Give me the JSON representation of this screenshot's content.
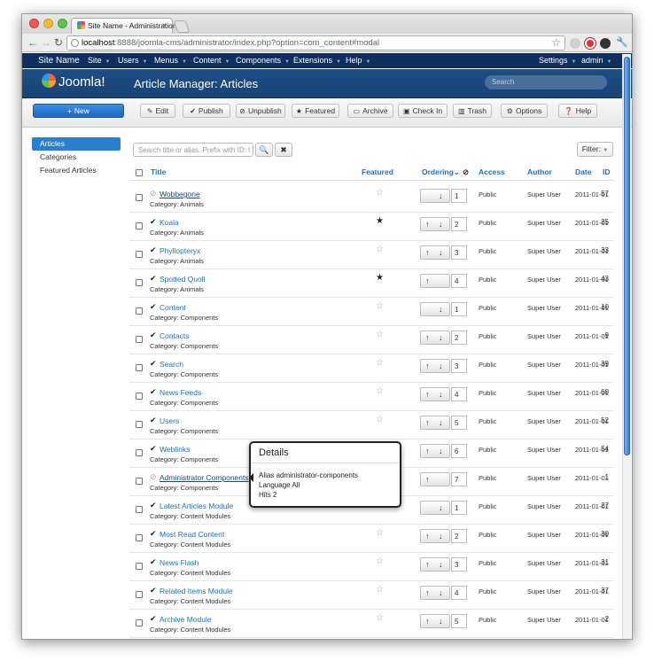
{
  "browser": {
    "tab_title": "Site Name - Administration",
    "url_host": "localhost",
    "url_rest": ":8888/joomla-cms/administrator/index.php?option=com_content#modal"
  },
  "nav": {
    "site_name": "Site Name",
    "menus": [
      "Site",
      "Users",
      "Menus",
      "Content",
      "Components",
      "Extensions",
      "Help"
    ],
    "settings": "Settings",
    "admin": "admin"
  },
  "header": {
    "logo": "Joomla!",
    "title": "Article Manager: Articles",
    "search_placeholder": "Search"
  },
  "toolbar": {
    "new": "New",
    "edit": "Edit",
    "publish": "Publish",
    "unpublish": "Unpublish",
    "featured": "Featured",
    "archive": "Archive",
    "checkin": "Check In",
    "trash": "Trash",
    "options": "Options",
    "help": "Help"
  },
  "sidebar": {
    "items": [
      "Articles",
      "Categories",
      "Featured Articles"
    ]
  },
  "filter": {
    "placeholder": "Search title or alias. Prefix with ID: t",
    "filter_label": "Filter:"
  },
  "table": {
    "headers": {
      "title": "Title",
      "featured": "Featured",
      "ordering": "Ordering",
      "access": "Access",
      "author": "Author",
      "date": "Date",
      "id": "ID"
    },
    "rows": [
      {
        "title": "Wobbegone",
        "category": "Category: Animals",
        "published": false,
        "featured": false,
        "up": false,
        "down": true,
        "order": "1",
        "access": "Public",
        "author": "Super User",
        "date": "2011-01-01",
        "id": "57"
      },
      {
        "title": "Koala",
        "category": "Category: Animals",
        "published": true,
        "featured": true,
        "up": true,
        "down": true,
        "order": "2",
        "access": "Public",
        "author": "Super User",
        "date": "2011-01-01",
        "id": "25"
      },
      {
        "title": "Phyllopteryx",
        "category": "Category: Animals",
        "published": true,
        "featured": false,
        "up": true,
        "down": true,
        "order": "3",
        "access": "Public",
        "author": "Super User",
        "date": "2011-01-01",
        "id": "33"
      },
      {
        "title": "Spotted Quoll",
        "category": "Category: Animals",
        "published": true,
        "featured": true,
        "up": true,
        "down": false,
        "order": "4",
        "access": "Public",
        "author": "Super User",
        "date": "2011-01-01",
        "id": "43"
      },
      {
        "title": "Content",
        "category": "Category: Components",
        "published": true,
        "featured": false,
        "up": false,
        "down": true,
        "order": "1",
        "access": "Public",
        "author": "Super User",
        "date": "2011-01-01",
        "id": "10"
      },
      {
        "title": "Contacts",
        "category": "Category: Components",
        "published": true,
        "featured": false,
        "up": true,
        "down": true,
        "order": "2",
        "access": "Public",
        "author": "Super User",
        "date": "2011-01-01",
        "id": "9"
      },
      {
        "title": "Search",
        "category": "Category: Components",
        "published": true,
        "featured": false,
        "up": true,
        "down": true,
        "order": "3",
        "access": "Public",
        "author": "Super User",
        "date": "2011-01-01",
        "id": "39"
      },
      {
        "title": "News Feeds",
        "category": "Category: Components",
        "published": true,
        "featured": false,
        "up": true,
        "down": true,
        "order": "4",
        "access": "Public",
        "author": "Super User",
        "date": "2011-01-01",
        "id": "60"
      },
      {
        "title": "Users",
        "category": "Category: Components",
        "published": true,
        "featured": false,
        "up": true,
        "down": true,
        "order": "5",
        "access": "Public",
        "author": "Super User",
        "date": "2011-01-01",
        "id": "52"
      },
      {
        "title": "Weblinks",
        "category": "Category: Components",
        "published": true,
        "featured": false,
        "up": true,
        "down": true,
        "order": "6",
        "access": "Public",
        "author": "Super User",
        "date": "2011-01-01",
        "id": "54"
      },
      {
        "title": "Administrator Components",
        "category": "Category: Components",
        "published": false,
        "featured": false,
        "up": true,
        "down": false,
        "order": "7",
        "access": "Public",
        "author": "Super User",
        "date": "2011-01-01",
        "id": "1"
      },
      {
        "title": "Latest Articles Module",
        "category": "Category: Content Modules",
        "published": true,
        "featured": false,
        "up": false,
        "down": true,
        "order": "1",
        "access": "Public",
        "author": "Super User",
        "date": "2011-01-01",
        "id": "27"
      },
      {
        "title": "Most Read Content",
        "category": "Category: Content Modules",
        "published": true,
        "featured": false,
        "up": true,
        "down": true,
        "order": "2",
        "access": "Public",
        "author": "Super User",
        "date": "2011-01-01",
        "id": "30"
      },
      {
        "title": "News Flash",
        "category": "Category: Content Modules",
        "published": true,
        "featured": false,
        "up": true,
        "down": true,
        "order": "3",
        "access": "Public",
        "author": "Super User",
        "date": "2011-01-01",
        "id": "31"
      },
      {
        "title": "Related Items Module",
        "category": "Category: Content Modules",
        "published": true,
        "featured": false,
        "up": true,
        "down": true,
        "order": "4",
        "access": "Public",
        "author": "Super User",
        "date": "2011-01-01",
        "id": "37"
      },
      {
        "title": "Archive Module",
        "category": "Category: Content Modules",
        "published": true,
        "featured": false,
        "up": true,
        "down": true,
        "order": "5",
        "access": "Public",
        "author": "Super User",
        "date": "2011-01-01",
        "id": "2"
      }
    ]
  },
  "tooltip": {
    "title": "Details",
    "lines": [
      "Alias administrator-components",
      "Language All",
      "Hits 2"
    ]
  },
  "colors": {
    "accent": "#1b73c0",
    "navbar": "#0f2f5f",
    "header": "#1e4e86",
    "new_button": "#2a7fd0"
  }
}
